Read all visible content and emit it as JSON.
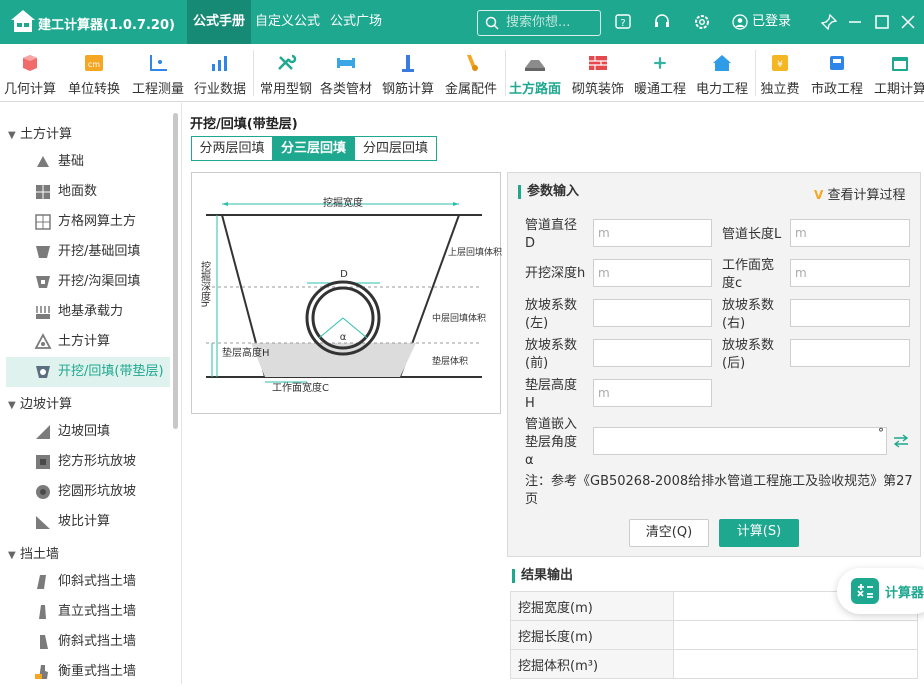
{
  "app": {
    "title": "建工计算器(1.0.7.20)"
  },
  "nav": {
    "tabs": [
      "公式手册",
      "自定义公式",
      "公式广场"
    ]
  },
  "search": {
    "placeholder": "搜索你想..."
  },
  "user": {
    "login_label": "已登录"
  },
  "toolbar": {
    "items": [
      "几何计算",
      "单位转换",
      "工程测量",
      "行业数据",
      "常用型钢",
      "各类管材",
      "钢筋计算",
      "金属配件",
      "土方路面",
      "砌筑装饰",
      "暖通工程",
      "电力工程",
      "独立费",
      "市政工程",
      "工期计算"
    ]
  },
  "sidebar": {
    "groups": [
      "土方计算",
      "边坡计算",
      "挡土墙"
    ],
    "items": [
      "基础",
      "地面数",
      "方格网算土方",
      "开挖/基础回填",
      "开挖/沟渠回填",
      "地基承载力",
      "土方计算",
      "开挖/回填(带垫层)",
      "边坡回填",
      "挖方形坑放坡",
      "挖圆形坑放坡",
      "坡比计算",
      "仰斜式挡土墙",
      "直立式挡土墙",
      "俯斜式挡土墙",
      "衡重式挡土墙"
    ]
  },
  "main": {
    "title": "开挖/回填(带垫层)",
    "segments": [
      "分两层回填",
      "分三层回填",
      "分四层回填"
    ]
  },
  "diagram": {
    "labels": {
      "width": "挖掘宽度",
      "depth": "挖掘深度h",
      "upper": "上层回填体积",
      "middle": "中层回填体积",
      "cushion": "垫层体积",
      "cushion_h": "垫层高度H",
      "workface": "工作面宽度C",
      "d": "D",
      "alpha": "α"
    }
  },
  "input": {
    "heading": "参数输入",
    "process_label": "查看计算过程",
    "fields": [
      {
        "label": "管道直径D",
        "placeholder": "m"
      },
      {
        "label": "管道长度L",
        "placeholder": "m"
      },
      {
        "label": "开挖深度h",
        "placeholder": "m"
      },
      {
        "label": "工作面宽度c",
        "placeholder": "m"
      },
      {
        "label": "放坡系数(左)",
        "placeholder": ""
      },
      {
        "label": "放坡系数(右)",
        "placeholder": ""
      },
      {
        "label": "放坡系数(前)",
        "placeholder": ""
      },
      {
        "label": "放坡系数(后)",
        "placeholder": ""
      },
      {
        "label": "垫层高度H",
        "placeholder": "m"
      },
      {
        "label": "管道嵌入垫层角度α",
        "placeholder": ""
      }
    ],
    "degree_unit": "°",
    "note": "注：参考《GB50268-2008给排水管道工程施工及验收规范》第27页",
    "clear_label": "清空(Q)",
    "calc_label": "计算(S)"
  },
  "result": {
    "heading": "结果输出",
    "rows": [
      "挖掘宽度(m)",
      "挖掘长度(m)",
      "挖掘体积(m³)"
    ]
  },
  "float": {
    "label": "计算器"
  },
  "colors": {
    "accent": "#1fa890",
    "accent_dark": "#178a76"
  }
}
